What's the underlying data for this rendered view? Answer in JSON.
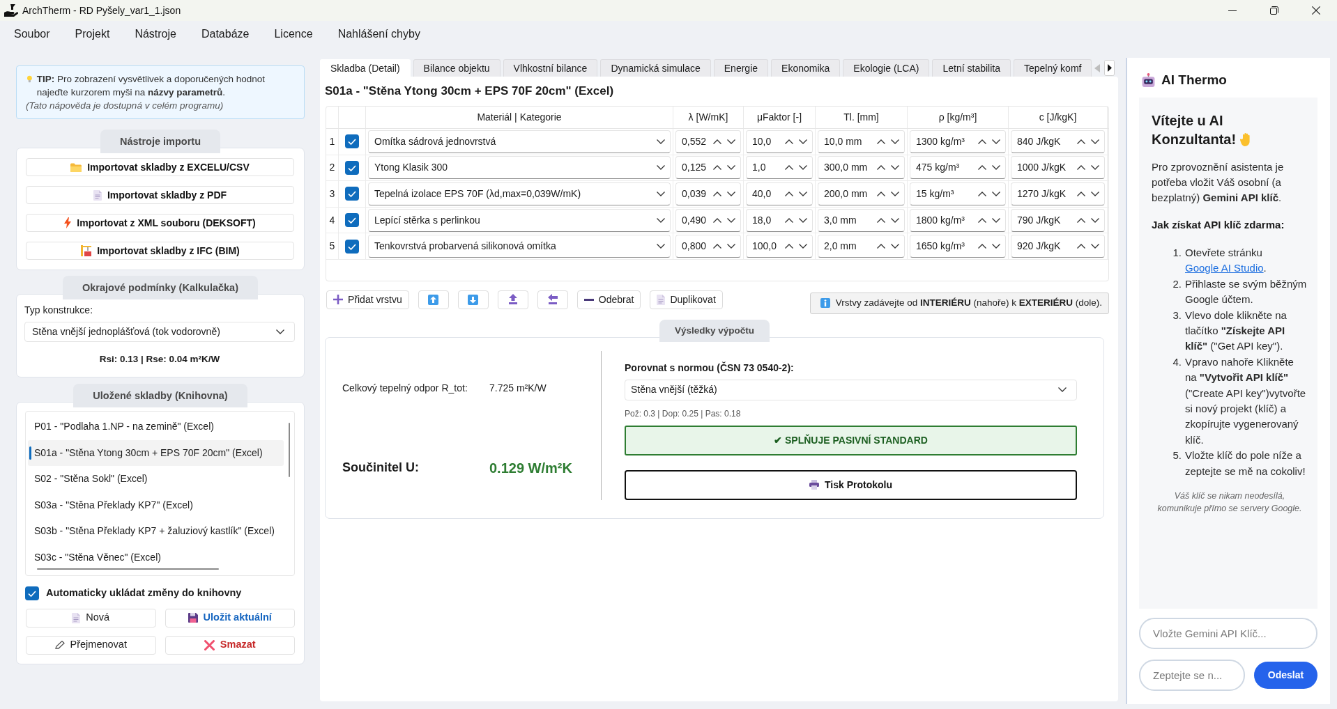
{
  "window": {
    "title": "ArchTherm - RD Pyšely_var1_1.json"
  },
  "menu": [
    "Soubor",
    "Projekt",
    "Nástroje",
    "Databáze",
    "Licence",
    "Nahlášení chyby"
  ],
  "sidebar": {
    "tip": {
      "text": "**TIP:** Pro zobrazení vysvětlivek a doporučených hodnot najeďte kurzorem myši na **názvy parametrů**.",
      "note": "(Tato nápověda je dostupná v celém programu)"
    },
    "import_tools": {
      "title": "Nástroje importu",
      "buttons": [
        {
          "kind": "excel",
          "label": "Importovat skladby z EXCELU/CSV"
        },
        {
          "kind": "pdf",
          "label": "Importovat skladby z PDF"
        },
        {
          "kind": "xml",
          "label": "Importovat z XML souboru (DEKSOFT)"
        },
        {
          "kind": "ifc",
          "label": "Importovat skladby z IFC (BIM)"
        }
      ]
    },
    "boundary_conditions": {
      "title": "Okrajové podmínky (Kalkulačka)",
      "construction_label": "Typ konstrukce:",
      "construction_type": "Stěna vnější jednoplášťová (tok vodorovně)",
      "summary": "Rsi: 0.13 | Rse: 0.04 m²K/W"
    },
    "library": {
      "title": "Uložené skladby (Knihovna)",
      "items": [
        {
          "label": "P01 - \"Podlaha 1.NP - na zemině\" (Excel)",
          "selected": false
        },
        {
          "label": "S01a - \"Stěna Ytong 30cm + EPS 70F 20cm\" (Excel)",
          "selected": true
        },
        {
          "label": "S02 - \"Stěna Sokl\" (Excel)",
          "selected": false
        },
        {
          "label": "S03a - \"Stěna Překlady KP7\" (Excel)",
          "selected": false
        },
        {
          "label": "S03b - \"Stěna Překlady KP7 + žaluziový kastlík\" (Excel)",
          "selected": false
        },
        {
          "label": "S03c - \"Stěna Věnec\" (Excel)",
          "selected": false
        }
      ],
      "autosave": {
        "label": "Automaticky ukládat změny do knihovny",
        "checked": true
      },
      "buttons": [
        {
          "kind": "new",
          "label": "Nová"
        },
        {
          "kind": "save",
          "label": "Uložit aktuální"
        },
        {
          "kind": "rename",
          "label": "Přejmenovat"
        },
        {
          "kind": "delete",
          "label": "Smazat"
        }
      ]
    }
  },
  "tabs": [
    {
      "label": "Skladba (Detail)",
      "selected": true
    },
    {
      "label": "Bilance objektu",
      "selected": false
    },
    {
      "label": "Vlhkostní bilance",
      "selected": false
    },
    {
      "label": "Dynamická simulace",
      "selected": false
    },
    {
      "label": "Energie",
      "selected": false
    },
    {
      "label": "Ekonomika",
      "selected": false
    },
    {
      "label": "Ekologie (LCA)",
      "selected": false
    },
    {
      "label": "Letní stabilita",
      "selected": false
    },
    {
      "label": "Tepelný komf",
      "selected": false
    }
  ],
  "tab_scroll": {
    "left_enabled": false,
    "right_enabled": true
  },
  "composition": {
    "title": "S01a - \"Stěna Ytong 30cm + EPS 70F 20cm\" (Excel)",
    "table": {
      "columns": [
        "Materiál | Kategorie",
        "λ [W/mK]",
        "μFaktor [-]",
        "Tl. [mm]",
        "ρ [kg/m³]",
        "c [J/kgK]"
      ],
      "rows": [
        {
          "number": "1",
          "checked": true,
          "material": "Omítka sádrová jednovrstvá",
          "lambda": "0,552",
          "mu": "10,0",
          "thickness": "10,0 mm",
          "density": "1300 kg/m³",
          "heat_capacity": "840 J/kgK"
        },
        {
          "number": "2",
          "checked": true,
          "material": "Ytong Klasik 300",
          "lambda": "0,125",
          "mu": "1,0",
          "thickness": "300,0 mm",
          "density": "475 kg/m³",
          "heat_capacity": "1000 J/kgK"
        },
        {
          "number": "3",
          "checked": true,
          "material": "Tepelná izolace EPS 70F (λd,max=0,039W/mK)",
          "lambda": "0,039",
          "mu": "40,0",
          "thickness": "200,0 mm",
          "density": "15 kg/m³",
          "heat_capacity": "1270 J/kgK"
        },
        {
          "number": "4",
          "checked": true,
          "material": "Lepící stěrka s perlinkou",
          "lambda": "0,490",
          "mu": "18,0",
          "thickness": "3,0 mm",
          "density": "1800 kg/m³",
          "heat_capacity": "790 J/kgK"
        },
        {
          "number": "5",
          "checked": true,
          "material": "Tenkovrstvá probarvená silikonová omítka",
          "lambda": "0,800",
          "mu": "100,0",
          "thickness": "2,0 mm",
          "density": "1650 kg/m³",
          "heat_capacity": "920 J/kgK"
        }
      ]
    },
    "toolbar": [
      {
        "kind": "add",
        "label": "Přidat vrstvu"
      },
      {
        "kind": "up"
      },
      {
        "kind": "down"
      },
      {
        "kind": "top"
      },
      {
        "kind": "end"
      },
      {
        "kind": "remove",
        "label": "Odebrat"
      },
      {
        "kind": "duplicate",
        "label": "Duplikovat"
      }
    ],
    "hint": "Vrstvy zadávejte od **INTERIÉRU** (nahoře) k **EXTERIÉRU** (dole)."
  },
  "results": {
    "title": "Výsledky výpočtu",
    "r_total_label": "Celkový tepelný odpor R_tot:",
    "r_total_value": "7.725 m²K/W",
    "u_label": "Součinitel U:",
    "u_value": "0.129 W/m²K",
    "norm_label": "Porovnat s normou (ČSN 73 0540-2):",
    "norm_type": "Stěna vnější (těžká)",
    "norm_limits": "Pož: 0.3 | Dop: 0.25 | Pas: 0.18",
    "verdict": {
      "text": "✔ SPLŇUJE PASIVNÍ STANDARD",
      "passed": true
    },
    "print_button": "Tisk Protokolu"
  },
  "assistant": {
    "title": "AI Thermo",
    "welcome_heading": "Vítejte u AI Konzultanta!",
    "intro": "Pro zprovoznění asistenta je potřeba vložit Váš osobní (a bezplatný) **Gemini API klíč**.",
    "howto_heading": "Jak získat API klíč zdarma:",
    "steps": [
      {
        "number": "1.",
        "text": "Otevřete stránku",
        "link": "Google AI Studio",
        "text_after": "."
      },
      {
        "number": "2.",
        "text": "Přihlaste se svým běžným Google účtem."
      },
      {
        "number": "3.",
        "text": "Vlevo dole klikněte na tlačítko **\"Získejte API klíč\"** (\"Get API key\")."
      },
      {
        "number": "4.",
        "text": "Vpravo nahoře Klikněte na **\"Vytvořit API klíč\"** (\"Create API key\")vytvořte si nový projekt (klíč) a zkopírujte vygenerovaný klíč."
      },
      {
        "number": "5.",
        "text": "Vložte klíč do pole níže a zeptejte se mě na cokoliv!"
      }
    ],
    "privacy_note": "Váš klíč se nikam neodesílá, komunikuje přímo se servery Google.",
    "api_key_placeholder": "Vložte Gemini API Klíč...",
    "question_placeholder": "Zeptejte se n...",
    "send_button": "Odeslat"
  }
}
